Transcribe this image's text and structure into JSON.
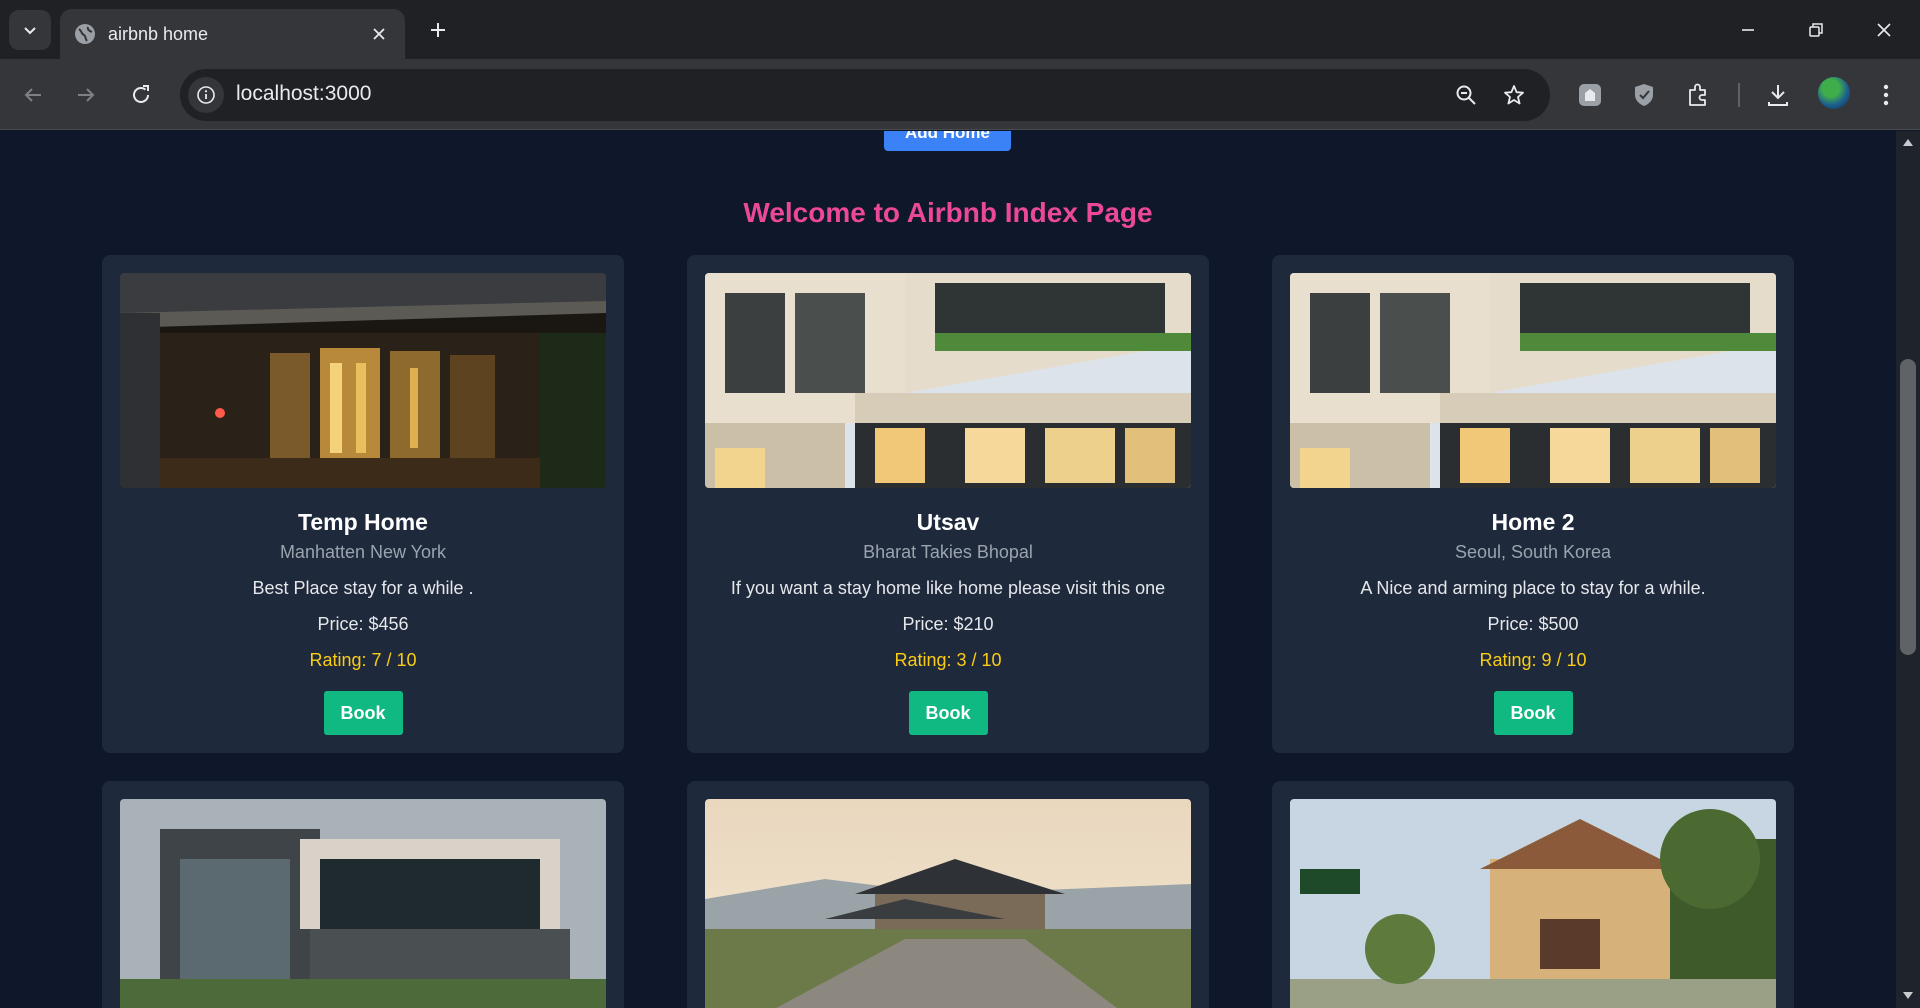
{
  "browser": {
    "tab_title": "airbnb home",
    "url": "localhost:3000"
  },
  "page": {
    "add_home_label": "Add Home",
    "heading": "Welcome to Airbnb Index Page",
    "homes": [
      {
        "name": "Temp Home",
        "location": "Manhatten New York",
        "description": "Best Place stay for a while .",
        "price": "Price: $456",
        "rating": "Rating: 7 / 10",
        "book_label": "Book",
        "photo": "night-hotel-entrance"
      },
      {
        "name": "Utsav",
        "location": "Bharat Takies Bhopal",
        "description": "If you want a stay home like home please visit this one",
        "price": "Price: $210",
        "rating": "Rating: 3 / 10",
        "book_label": "Book",
        "photo": "modern-villa-terrace"
      },
      {
        "name": "Home 2",
        "location": "Seoul, South Korea",
        "description": "A Nice and arming place to stay for a while.",
        "price": "Price: $500",
        "rating": "Rating: 9 / 10",
        "book_label": "Book",
        "photo": "modern-villa-terrace"
      },
      {
        "photo": "grey-modern-house"
      },
      {
        "photo": "resort-pagoda-house"
      },
      {
        "photo": "suburban-hotel"
      }
    ]
  },
  "colors": {
    "page_bg": "#0f172a",
    "card_bg": "#1e293b",
    "heading": "#ec4899",
    "rating": "#facc15",
    "book_button": "#10b981",
    "add_home_button": "#3b82f6"
  }
}
